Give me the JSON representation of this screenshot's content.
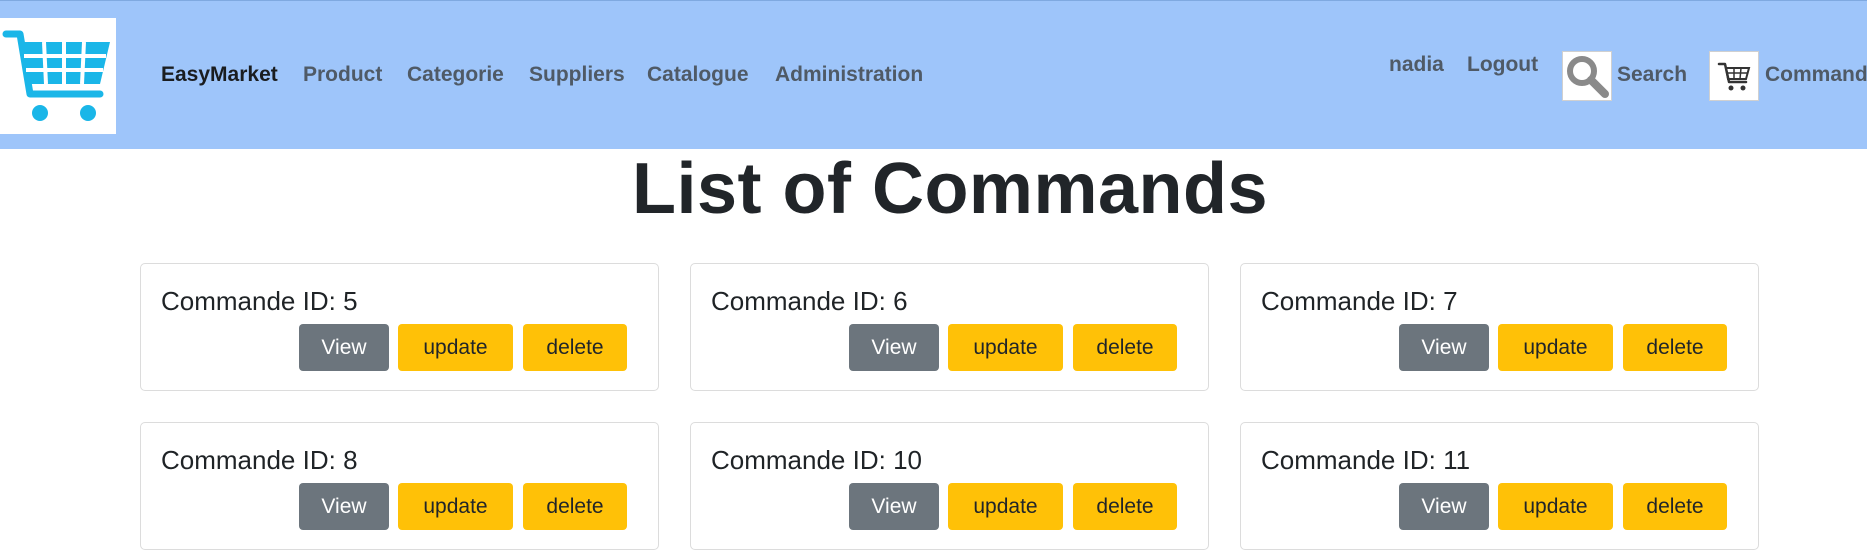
{
  "navbar": {
    "brand": "EasyMarket",
    "links": [
      "Product",
      "Categorie",
      "Suppliers",
      "Catalogue",
      "Administration"
    ],
    "user": "nadia",
    "logout": "Logout",
    "search": "Search",
    "commands": "Commande"
  },
  "page": {
    "title": "List of Commands"
  },
  "commands": [
    {
      "title": "Commande ID: 5",
      "view": "View",
      "update": "update",
      "delete": "delete"
    },
    {
      "title": "Commande ID: 6",
      "view": "View",
      "update": "update",
      "delete": "delete"
    },
    {
      "title": "Commande ID: 7",
      "view": "View",
      "update": "update",
      "delete": "delete"
    },
    {
      "title": "Commande ID: 8",
      "view": "View",
      "update": "update",
      "delete": "delete"
    },
    {
      "title": "Commande ID: 10",
      "view": "View",
      "update": "update",
      "delete": "delete"
    },
    {
      "title": "Commande ID: 11",
      "view": "View",
      "update": "update",
      "delete": "delete"
    }
  ],
  "colors": {
    "navbar": "#9ec5fa",
    "view_button": "#6c757d",
    "action_button": "#ffc107",
    "cart_icon": "#1ab6e8"
  }
}
